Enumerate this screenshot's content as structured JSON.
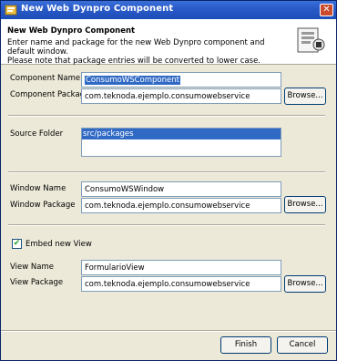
{
  "window": {
    "title": "New Web Dynpro Component",
    "close_glyph": "✕"
  },
  "banner": {
    "title": "New Web Dynpro Component",
    "description_line1": "Enter name and package for the new Web Dynpro component and default window.",
    "description_line2": "Please note that package entries will be converted to lower case."
  },
  "component": {
    "name_label": "Component Name",
    "name_value": "ConsumoWSComponent",
    "package_label": "Component Package",
    "package_value": "com.teknoda.ejemplo.consumowebservice",
    "browse_label": "Browse..."
  },
  "source": {
    "label": "Source Folder",
    "items": [
      "src/packages"
    ]
  },
  "window_section": {
    "name_label": "Window Name",
    "name_value": "ConsumoWSWindow",
    "package_label": "Window Package",
    "package_value": "com.teknoda.ejemplo.consumowebservice",
    "browse_label": "Browse..."
  },
  "view": {
    "embed_label": "Embed new View",
    "embed_checked": true,
    "check_glyph": "✔",
    "name_label": "View Name",
    "name_value": "FormularioView",
    "package_label": "View Package",
    "package_value": "com.teknoda.ejemplo.consumowebservice",
    "browse_label": "Browse..."
  },
  "footer": {
    "finish_label": "Finish",
    "cancel_label": "Cancel"
  },
  "colors": {
    "titlebar": "#2a5bc9",
    "selection": "#316ac5",
    "dialog_bg": "#ece9d8"
  }
}
